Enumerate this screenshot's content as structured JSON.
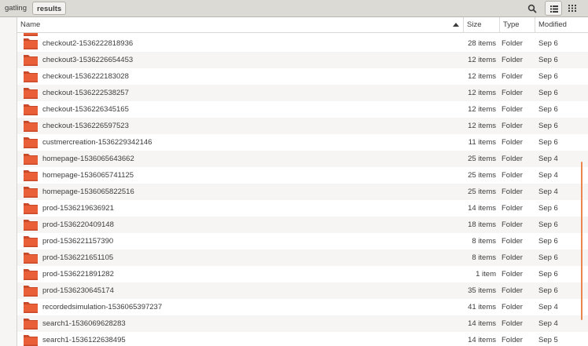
{
  "header": {
    "breadcrumbs": [
      "gatling",
      "results"
    ],
    "buttons": {
      "search": "search-icon",
      "list_view": "list-view-icon",
      "grid_view": "grid-view-icon"
    }
  },
  "columns": {
    "name": "Name",
    "size": "Size",
    "type": "Type",
    "modified": "Modified",
    "sort_icon": "sort-ascending-icon"
  },
  "colors": {
    "folder_orange": "#e95f37",
    "folder_dark": "#c84a28",
    "scroll_accent": "#e9874e",
    "header_bg": "#dcdad5"
  },
  "rows": [
    {
      "name": "checkout2-1536222818936",
      "size": "28 items",
      "type": "Folder",
      "modified": "Sep 6"
    },
    {
      "name": "checkout3-1536226654453",
      "size": "12 items",
      "type": "Folder",
      "modified": "Sep 6"
    },
    {
      "name": "checkout-1536222183028",
      "size": "12 items",
      "type": "Folder",
      "modified": "Sep 6"
    },
    {
      "name": "checkout-1536222538257",
      "size": "12 items",
      "type": "Folder",
      "modified": "Sep 6"
    },
    {
      "name": "checkout-1536226345165",
      "size": "12 items",
      "type": "Folder",
      "modified": "Sep 6"
    },
    {
      "name": "checkout-1536226597523",
      "size": "12 items",
      "type": "Folder",
      "modified": "Sep 6"
    },
    {
      "name": "custmercreation-1536229342146",
      "size": "11 items",
      "type": "Folder",
      "modified": "Sep 6"
    },
    {
      "name": "homepage-1536065643662",
      "size": "25 items",
      "type": "Folder",
      "modified": "Sep 4"
    },
    {
      "name": "homepage-1536065741125",
      "size": "25 items",
      "type": "Folder",
      "modified": "Sep 4"
    },
    {
      "name": "homepage-1536065822516",
      "size": "25 items",
      "type": "Folder",
      "modified": "Sep 4"
    },
    {
      "name": "prod-1536219636921",
      "size": "14 items",
      "type": "Folder",
      "modified": "Sep 6"
    },
    {
      "name": "prod-1536220409148",
      "size": "18 items",
      "type": "Folder",
      "modified": "Sep 6"
    },
    {
      "name": "prod-1536221157390",
      "size": "8 items",
      "type": "Folder",
      "modified": "Sep 6"
    },
    {
      "name": "prod-1536221651105",
      "size": "8 items",
      "type": "Folder",
      "modified": "Sep 6"
    },
    {
      "name": "prod-1536221891282",
      "size": "1 item",
      "type": "Folder",
      "modified": "Sep 6"
    },
    {
      "name": "prod-1536230645174",
      "size": "35 items",
      "type": "Folder",
      "modified": "Sep 6"
    },
    {
      "name": "recordedsimulation-1536065397237",
      "size": "41 items",
      "type": "Folder",
      "modified": "Sep 4"
    },
    {
      "name": "search1-1536069628283",
      "size": "14 items",
      "type": "Folder",
      "modified": "Sep 4"
    },
    {
      "name": "search1-1536122638495",
      "size": "14 items",
      "type": "Folder",
      "modified": "Sep 5"
    }
  ]
}
